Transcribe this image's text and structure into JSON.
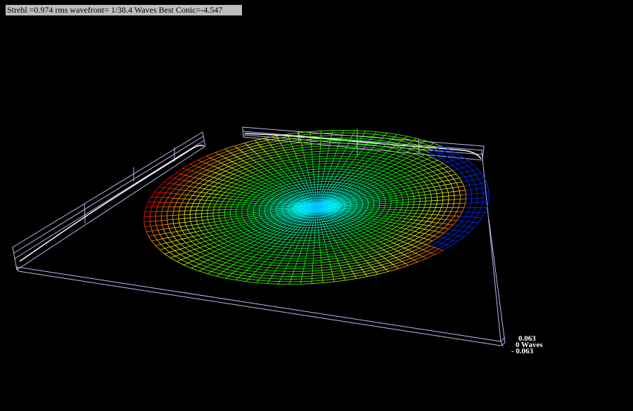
{
  "status": {
    "text": "Strehl =0.974 rms wavefront= 1/38.4 Waves Best Conic=-4.547"
  },
  "scale": {
    "top_label": "0.063",
    "mid_label": "0 Waves",
    "bottom_label": "- 0.063"
  },
  "colors": {
    "background": "#000000",
    "frame": "#b9b9f0",
    "profile_trace": "#ffffff",
    "status_bg": "#bdbdbd"
  }
}
